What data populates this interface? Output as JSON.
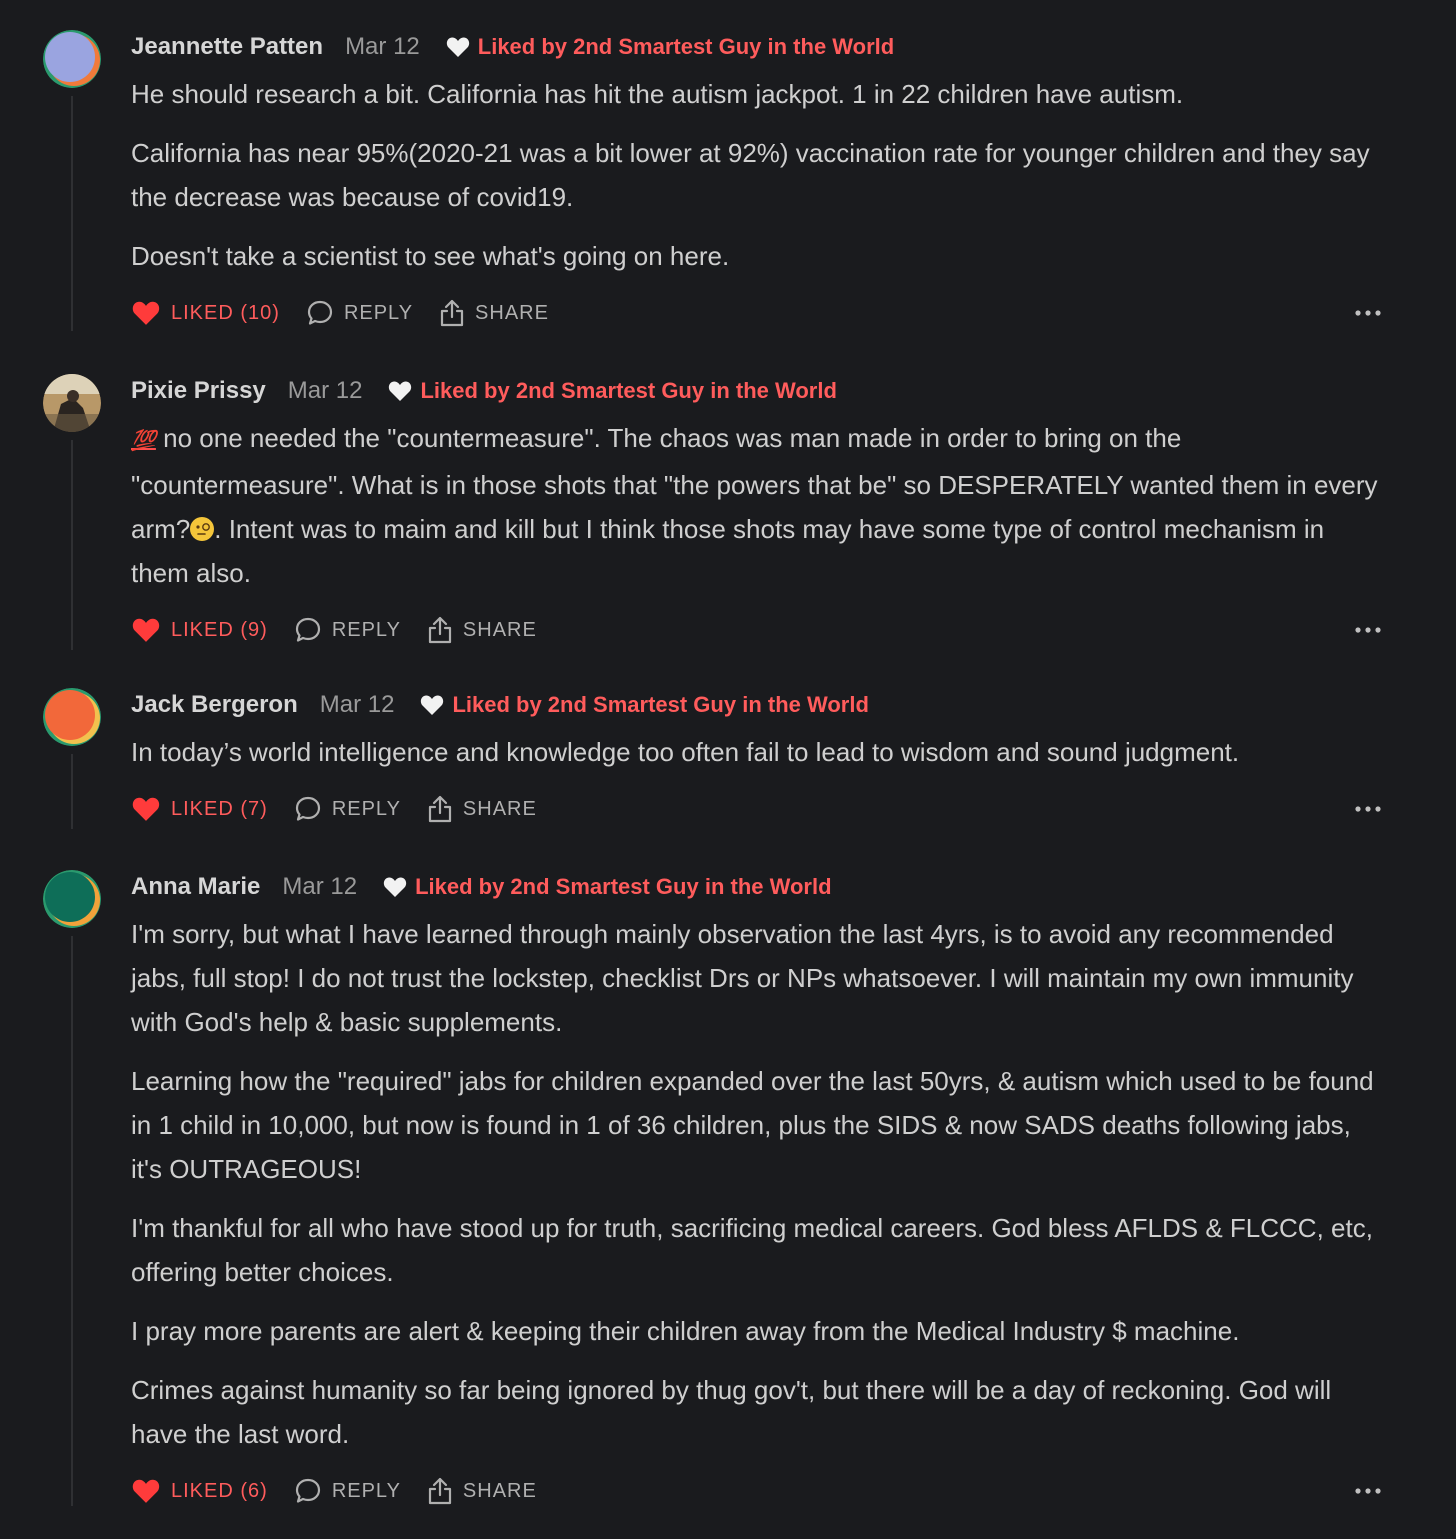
{
  "colors": {
    "background": "#1a1b1e",
    "accent": "#ff5c5c",
    "text": "#cfcfcf",
    "muted": "#9a9a9a"
  },
  "comments": [
    {
      "author": "Jeannette Patten",
      "date": "Mar 12",
      "liked_by": "Liked by 2nd Smartest Guy in the World",
      "paragraphs": [
        "He should research a bit. California has hit the autism jackpot. 1 in 22 children have autism.",
        "California has near 95%(2020-21 was a bit lower at 92%) vaccination rate for younger children and they say the decrease was because of covid19.",
        "Doesn't take a scientist to see what's going on here."
      ],
      "like_label": "LIKED (10)",
      "reply_label": "REPLY",
      "share_label": "SHARE"
    },
    {
      "author": "Pixie Prissy",
      "date": "Mar 12",
      "liked_by": "Liked by 2nd Smartest Guy in the World",
      "emoji_100": "💯",
      "p_part1": " no one needed the \"countermeasure\". The chaos was man made in order to bring on the \"countermeasure\". What is in those shots that \"the powers that be\" so DESPERATELY wanted them in every arm?",
      "p_part2": ". Intent was to maim and kill but I think those shots may have some type of control mechanism in them also.",
      "like_label": "LIKED (9)",
      "reply_label": "REPLY",
      "share_label": "SHARE"
    },
    {
      "author": "Jack Bergeron",
      "date": "Mar 12",
      "liked_by": "Liked by 2nd Smartest Guy in the World",
      "paragraphs": [
        "In today’s world intelligence and knowledge too often fail to lead to wisdom and sound judgment."
      ],
      "like_label": "LIKED (7)",
      "reply_label": "REPLY",
      "share_label": "SHARE"
    },
    {
      "author": "Anna Marie",
      "date": "Mar 12",
      "liked_by": "Liked by 2nd Smartest Guy in the World",
      "paragraphs": [
        "I'm sorry, but what I have learned through mainly observation the last 4yrs, is to avoid any recommended jabs, full stop! I do not trust the lockstep, checklist Drs or NPs whatsoever. I will maintain my own immunity with God's help & basic supplements.",
        "Learning how the \"required\" jabs for children expanded over the last 50yrs, & autism which used to be found in 1 child in 10,000, but now is found in 1 of 36 children, plus the SIDS & now SADS deaths following jabs, it's OUTRAGEOUS!",
        "I'm thankful for all who have stood up for truth, sacrificing medical careers. God bless AFLDS & FLCCC, etc, offering better choices.",
        "I pray more parents are alert & keeping their children away from the Medical Industry $ machine.",
        "Crimes against humanity so far being ignored by thug gov't, but there will be a day of reckoning. God will have the last word."
      ],
      "like_label": "LIKED (6)",
      "reply_label": "REPLY",
      "share_label": "SHARE"
    }
  ]
}
